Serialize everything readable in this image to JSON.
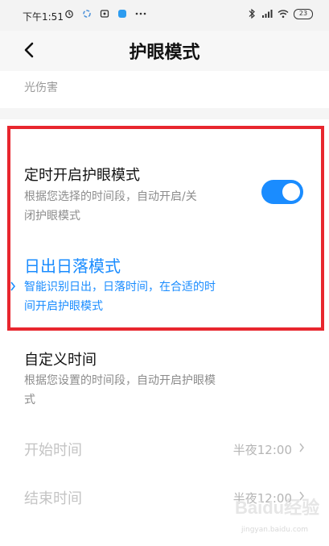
{
  "status_bar": {
    "time": "下午1:51",
    "battery": "23",
    "left_icons": [
      "alarm-icon",
      "sync-icon",
      "notification-icon",
      "app-icon",
      "more-dots-icon"
    ],
    "right_icons": [
      "bluetooth-icon",
      "signal-icon",
      "wifi-icon",
      "battery-icon"
    ]
  },
  "header": {
    "title": "护眼模式",
    "back_icon": "back-arrow-icon"
  },
  "fragment": {
    "line": "光伤害"
  },
  "scheduled": {
    "title": "定时开启护眼模式",
    "desc_line1": "根据您选择的时间段，自动开启/关",
    "desc_line2": "闭护眼模式",
    "enabled": true
  },
  "sunrise_sunset": {
    "title": "日出日落模式",
    "desc_line1": "智能识别日出，日落时间，在合适的时",
    "desc_line2": "间开启护眼模式",
    "selected": true
  },
  "custom_time": {
    "title": "自定义时间",
    "desc_line1": "根据您设置的时间段，自动开启护眼模",
    "desc_line2": "式",
    "start_label": "开始时间",
    "start_value": "半夜12:00",
    "end_label": "结束时间",
    "end_value": "半夜12:00"
  },
  "watermark": {
    "main": "Baidu经验",
    "sub": "jingyan.baidu.com"
  },
  "colors": {
    "accent": "#1a8cff",
    "highlight_border": "#e8262e"
  }
}
